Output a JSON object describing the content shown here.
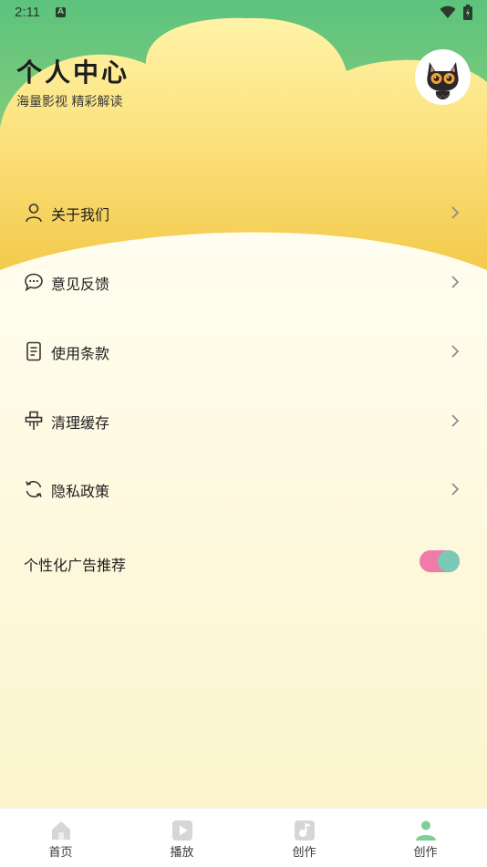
{
  "status_bar": {
    "time": "2:11",
    "notification_badge": "A"
  },
  "header": {
    "title": "个人中心",
    "subtitle": "海量影视 精彩解读",
    "avatar_icon": "black-cat-avatar"
  },
  "menu": [
    {
      "label": "关于我们",
      "icon": "person-icon"
    },
    {
      "label": "意见反馈",
      "icon": "chat-bubble-icon"
    },
    {
      "label": "使用条款",
      "icon": "document-icon"
    },
    {
      "label": "清理缓存",
      "icon": "broom-icon"
    },
    {
      "label": "隐私政策",
      "icon": "refresh-icon"
    }
  ],
  "ad_setting": {
    "label": "个性化广告推荐",
    "enabled": true
  },
  "bottom_nav": [
    {
      "label": "首页",
      "icon": "home-icon",
      "active": false
    },
    {
      "label": "播放",
      "icon": "play-icon",
      "active": false
    },
    {
      "label": "创作",
      "icon": "create-icon",
      "active": false
    },
    {
      "label": "创作",
      "icon": "profile-icon",
      "active": true
    }
  ],
  "colors": {
    "header_green": "#5ec47c",
    "cloud_yellow": "#f6d35a",
    "page_cream": "#fbf7d9",
    "toggle_pink": "#ef7ba8",
    "toggle_knob": "#79c9b5",
    "nav_active": "#7ccf95"
  }
}
